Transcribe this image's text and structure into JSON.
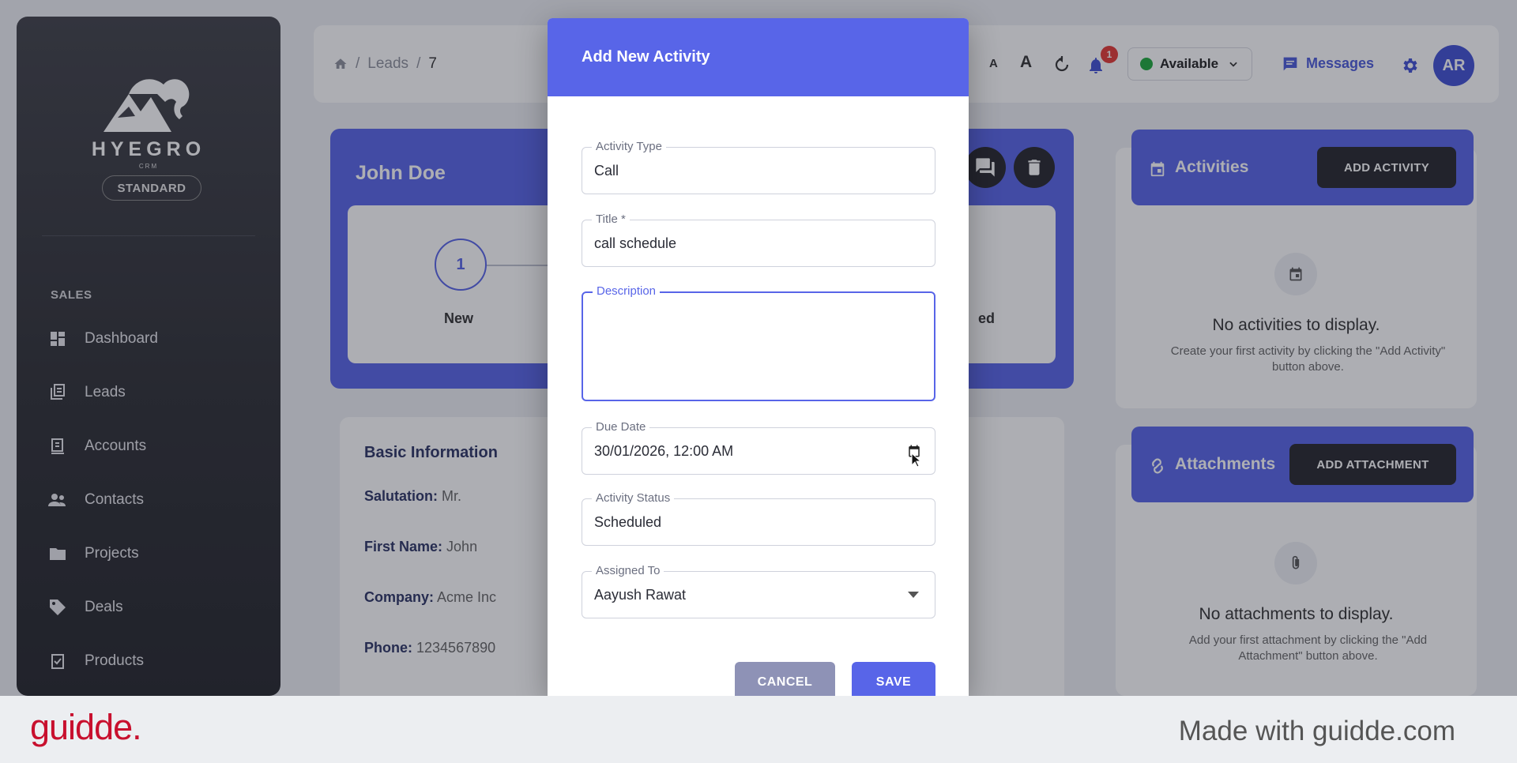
{
  "sidebar": {
    "logo_text": "HYEGRO",
    "logo_sub": "CRM",
    "plan": "STANDARD",
    "section": "SALES",
    "items": [
      {
        "label": "Dashboard",
        "icon": "dashboard-icon"
      },
      {
        "label": "Leads",
        "icon": "leads-icon"
      },
      {
        "label": "Accounts",
        "icon": "accounts-icon"
      },
      {
        "label": "Contacts",
        "icon": "contacts-icon"
      },
      {
        "label": "Projects",
        "icon": "folder-icon"
      },
      {
        "label": "Deals",
        "icon": "tag-icon"
      },
      {
        "label": "Products",
        "icon": "clipboard-check-icon"
      }
    ]
  },
  "topbar": {
    "breadcrumb": [
      "Leads",
      "7"
    ],
    "font_small": "A",
    "font_large": "A",
    "notifications_count": "1",
    "status": "Available",
    "messages": "Messages",
    "avatar_initials": "AR"
  },
  "lead": {
    "name": "John Doe",
    "step_number": "1",
    "step_label": "New",
    "step_label_right": "ed"
  },
  "basic_info": {
    "title": "Basic Information",
    "rows": [
      {
        "key": "Salutation:",
        "value": "Mr."
      },
      {
        "key": "First Name:",
        "value": "John"
      },
      {
        "key": "Company:",
        "value": "Acme Inc"
      },
      {
        "key": "Phone:",
        "value": "1234567890"
      }
    ]
  },
  "activities": {
    "title": "Activities",
    "button": "ADD ACTIVITY",
    "empty_title": "No activities to display.",
    "empty_sub": "Create your first activity by clicking the \"Add Activity\" button above."
  },
  "attachments": {
    "title": "Attachments",
    "button": "ADD ATTACHMENT",
    "empty_title": "No attachments to display.",
    "empty_sub": "Add your first attachment by clicking the \"Add Attachment\" button above."
  },
  "dialog": {
    "title": "Add New Activity",
    "activity_type": {
      "label": "Activity Type",
      "value": "Call"
    },
    "title_field": {
      "label": "Title *",
      "value": "call schedule"
    },
    "description": {
      "label": "Description",
      "value": ""
    },
    "due_date": {
      "label": "Due Date",
      "value": "30/01/2026, 12:00 AM"
    },
    "activity_status": {
      "label": "Activity Status",
      "value": "Scheduled"
    },
    "assigned_to": {
      "label": "Assigned To",
      "value": "Aayush Rawat"
    },
    "cancel": "CANCEL",
    "save": "SAVE"
  },
  "footer": {
    "brand": "guidde.",
    "tagline": "Made with guidde.com"
  },
  "colors": {
    "accent": "#5865e8",
    "sidebar": "#2e2f34",
    "brand_red": "#c8102e",
    "status_green": "#1faa3c"
  }
}
